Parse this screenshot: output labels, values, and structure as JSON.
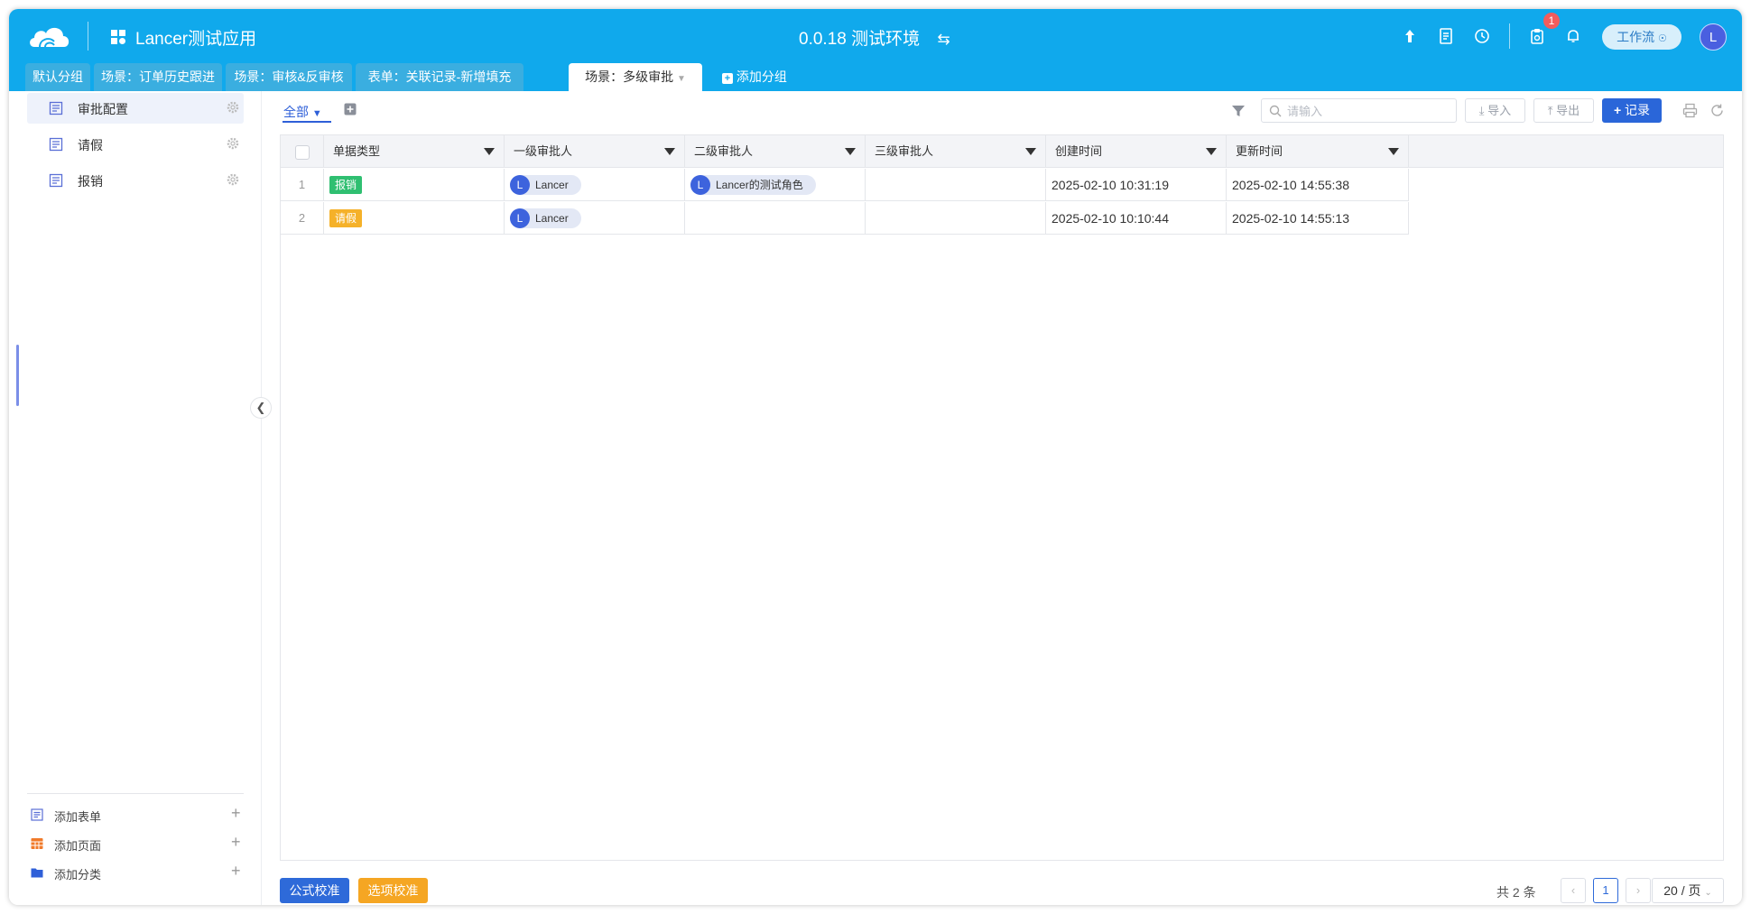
{
  "header": {
    "app_name": "Lancer测试应用",
    "env_label": "0.0.18 测试环境",
    "env_swap_icon": "swap-icon",
    "notification_count": "1",
    "workflow_label": "工作流",
    "avatar_letter": "L",
    "brand_color": "#10a9ec"
  },
  "tabs": [
    {
      "label": "默认分组"
    },
    {
      "label": "场景：订单历史跟进"
    },
    {
      "label": "场景：审核&反审核"
    },
    {
      "label": "表单：关联记录-新增填充"
    },
    {
      "label": "场景：多级审批",
      "active": true
    }
  ],
  "tab_add_label": "添加分组",
  "sidebar": {
    "items": [
      {
        "label": "审批配置",
        "active": true
      },
      {
        "label": "请假"
      },
      {
        "label": "报销"
      }
    ],
    "bottom": [
      {
        "label": "添加表单",
        "icon": "form-icon"
      },
      {
        "label": "添加页面",
        "icon": "table-icon"
      },
      {
        "label": "添加分类",
        "icon": "folder-icon"
      }
    ]
  },
  "toolbar": {
    "view_label": "全部",
    "search_placeholder": "请输入",
    "import_label": "导入",
    "export_label": "导出",
    "record_label": "记录"
  },
  "table": {
    "columns": [
      "单据类型",
      "一级审批人",
      "二级审批人",
      "三级审批人",
      "创建时间",
      "更新时间"
    ],
    "rows": [
      {
        "num": "1",
        "type": "报销",
        "type_color": "#2fbf71",
        "level1": "Lancer",
        "level2": "Lancer的测试角色",
        "level3": "",
        "created": "2025-02-10 10:31:19",
        "updated": "2025-02-10 14:55:38"
      },
      {
        "num": "2",
        "type": "请假",
        "type_color": "#f5b129",
        "level1": "Lancer",
        "level2": "",
        "level3": "",
        "created": "2025-02-10 10:10:44",
        "updated": "2025-02-10 14:55:13"
      }
    ],
    "avatar_letter": "L"
  },
  "footer": {
    "formula_label": "公式校准",
    "option_label": "选项校准",
    "total_text": "共 2 条",
    "current_page": "1",
    "page_size": "20 / 页"
  }
}
